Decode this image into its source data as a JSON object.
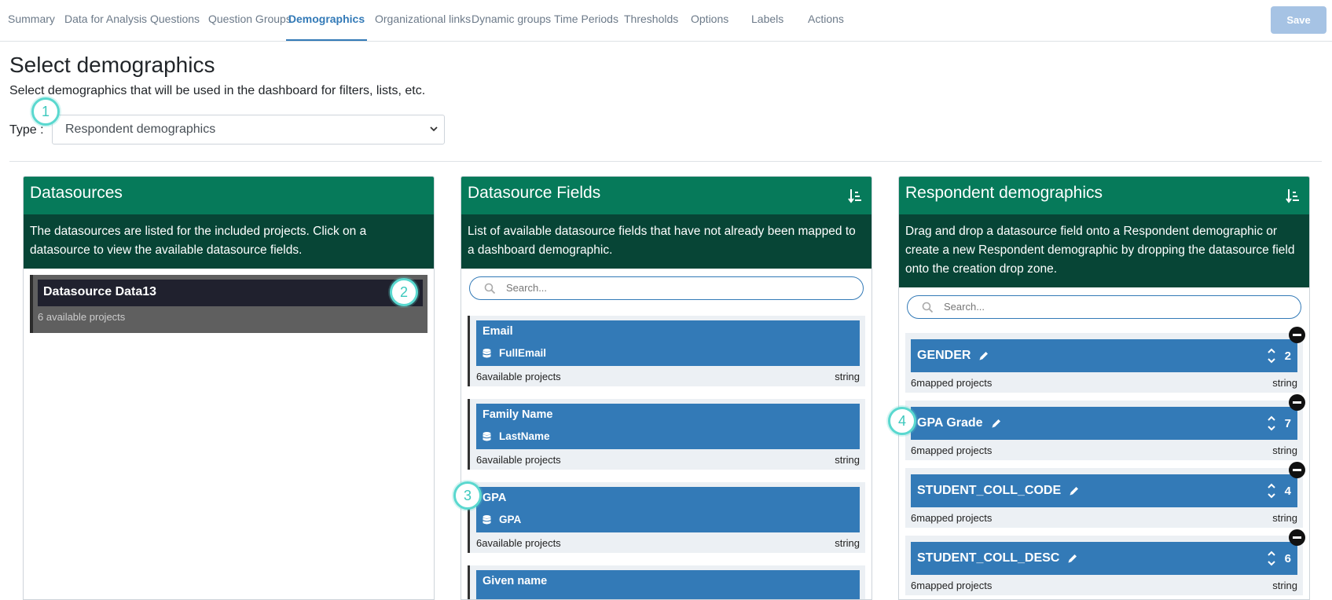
{
  "nav": {
    "tabs": [
      {
        "label": "Summary"
      },
      {
        "label": "Data for Analysis"
      },
      {
        "label": "Questions"
      },
      {
        "label": "Question Groups"
      },
      {
        "label": "Demographics"
      },
      {
        "label": "Organizational links"
      },
      {
        "label": "Dynamic groups"
      },
      {
        "label": "Time Periods"
      },
      {
        "label": "Thresholds"
      },
      {
        "label": "Options"
      },
      {
        "label": "Labels"
      },
      {
        "label": "Actions"
      }
    ],
    "active_tab": "Demographics",
    "save_label": "Save"
  },
  "page": {
    "title": "Select demographics",
    "subtitle": "Select demographics that will be used in the dashboard for filters, lists, etc.",
    "type_label": "Type :",
    "type_value": "Respondent demographics"
  },
  "callouts": [
    "1",
    "2",
    "3",
    "4"
  ],
  "datasources": {
    "title": "Datasources",
    "description": "The datasources are listed for the included projects. Click on a datasource to view the available datasource fields.",
    "items": [
      {
        "name": "Datasource Data13",
        "meta": "6 available projects"
      }
    ]
  },
  "fields": {
    "title": "Datasource Fields",
    "description": "List of available datasource fields that have not already been mapped to a dashboard demographic.",
    "search_placeholder": "Search...",
    "items": [
      {
        "name": "Email",
        "source": "FullEmail",
        "count": "6",
        "count_label": "available projects",
        "type": "string"
      },
      {
        "name": "Family Name",
        "source": "LastName",
        "count": "6",
        "count_label": "available projects",
        "type": "string"
      },
      {
        "name": "GPA",
        "source": "GPA",
        "count": "6",
        "count_label": "available projects",
        "type": "string"
      },
      {
        "name": "Given name"
      }
    ]
  },
  "demographics": {
    "title": "Respondent demographics",
    "description": "Drag and drop a datasource field onto a Respondent demographic or create a new Respondent demographic by dropping the datasource field onto the creation drop zone.",
    "search_placeholder": "Search...",
    "items": [
      {
        "name": "GENDER",
        "number": "2",
        "count": "6",
        "count_label": "mapped projects",
        "type": "string"
      },
      {
        "name": "GPA Grade",
        "number": "7",
        "count": "6",
        "count_label": "mapped projects",
        "type": "string"
      },
      {
        "name": "STUDENT_COLL_CODE",
        "number": "4",
        "count": "6",
        "count_label": "mapped projects",
        "type": "string"
      },
      {
        "name": "STUDENT_COLL_DESC",
        "number": "6",
        "count": "6",
        "count_label": "mapped projects",
        "type": "string"
      }
    ]
  },
  "colors": {
    "accent": "#337ab7",
    "panel_header": "#067a5a",
    "panel_description": "#074536",
    "callout": "#5ad8cf"
  },
  "icons": [
    "sort-icon",
    "search-icon",
    "database-icon",
    "pencil-icon",
    "sort-arrows-icon",
    "remove-icon",
    "chevron-down-icon"
  ]
}
